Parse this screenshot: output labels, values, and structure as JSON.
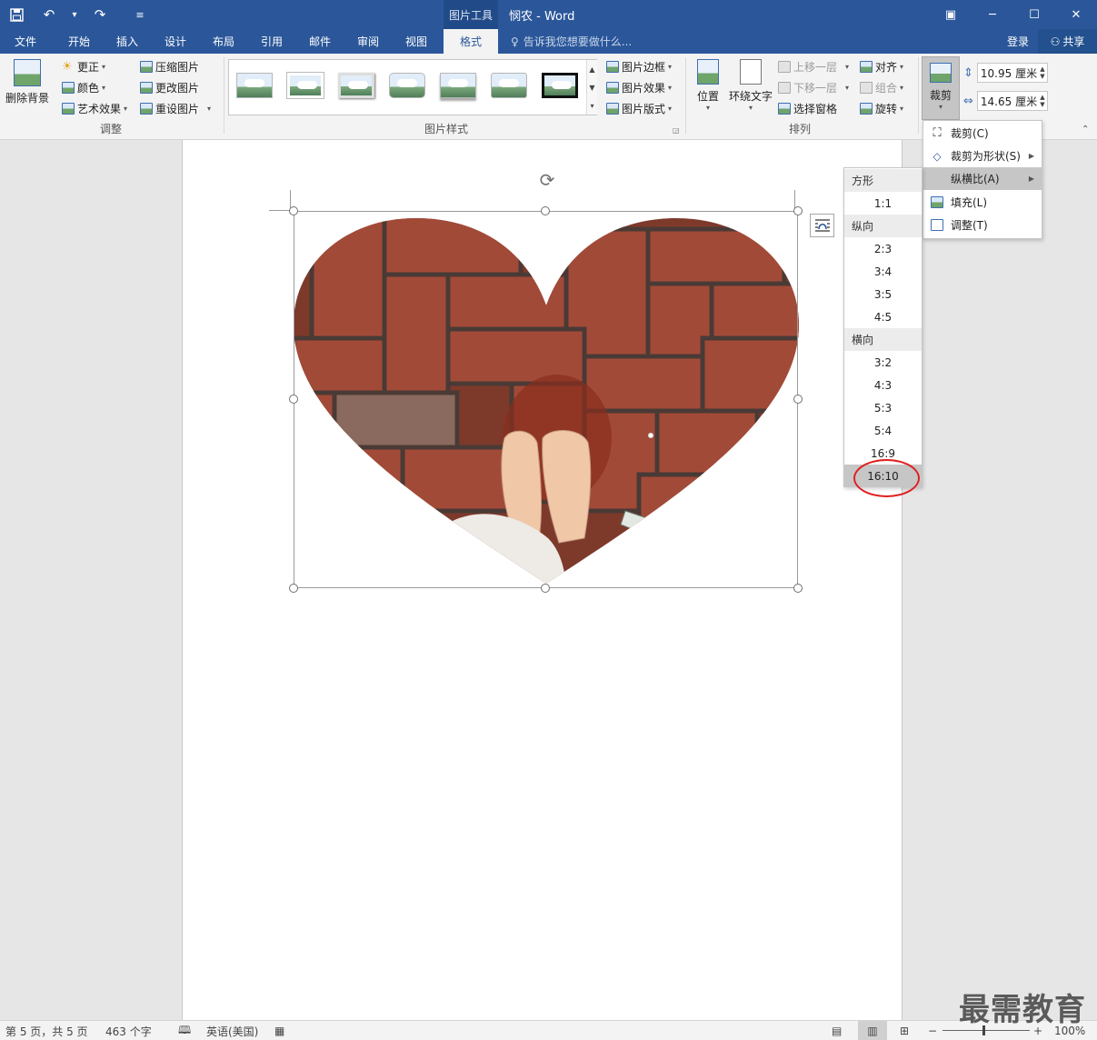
{
  "titlebar": {
    "context_tools": "图片工具",
    "doc_title": "悯农 - Word"
  },
  "tabs": [
    "文件",
    "开始",
    "插入",
    "设计",
    "布局",
    "引用",
    "邮件",
    "审阅",
    "视图",
    "格式"
  ],
  "tellme": "告诉我您想要做什么...",
  "account": {
    "login": "登录",
    "share": "共享"
  },
  "ribbon": {
    "adjust": {
      "label": "调整",
      "remove_bg": "删除背景",
      "corrections": "更正",
      "color": "颜色",
      "artistic": "艺术效果",
      "compress": "压缩图片",
      "change": "更改图片",
      "reset": "重设图片"
    },
    "styles": {
      "label": "图片样式",
      "border": "图片边框",
      "effects": "图片效果",
      "layout": "图片版式"
    },
    "arrange": {
      "label": "排列",
      "position": "位置",
      "wrap": "环绕文字",
      "forward": "上移一层",
      "backward": "下移一层",
      "selection": "选择窗格",
      "align": "对齐",
      "group": "组合",
      "rotate": "旋转"
    },
    "size": {
      "crop": "裁剪",
      "height": "10.95 厘米",
      "width": "14.65 厘米"
    }
  },
  "crop_menu": {
    "crop": "裁剪(C)",
    "crop_shape": "裁剪为形状(S)",
    "aspect": "纵横比(A)",
    "fill": "填充(L)",
    "fit": "调整(T)"
  },
  "aspect_menu": {
    "square_label": "方形",
    "square": [
      "1:1"
    ],
    "portrait_label": "纵向",
    "portrait": [
      "2:3",
      "3:4",
      "3:5",
      "4:5"
    ],
    "landscape_label": "横向",
    "landscape": [
      "3:2",
      "4:3",
      "5:3",
      "5:4",
      "16:9",
      "16:10"
    ]
  },
  "statusbar": {
    "page": "第 5 页，共 5 页",
    "words": "463 个字",
    "language": "英语(美国)",
    "zoom": "100%"
  },
  "watermark": "最需教育"
}
